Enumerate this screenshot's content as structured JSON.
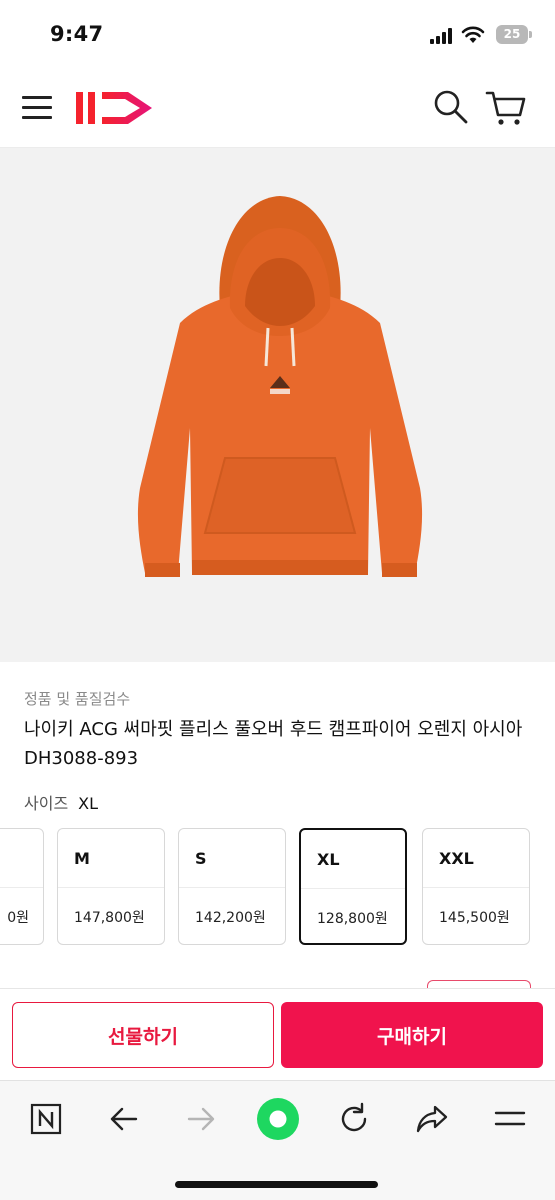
{
  "status_bar": {
    "time": "9:47",
    "battery": "25"
  },
  "header": {
    "logo_text": "11st",
    "icons": [
      "menu-icon",
      "search-icon",
      "cart-icon"
    ]
  },
  "product": {
    "authentic_label": "정품 및 품질검수",
    "title": "나이키 ACG 써마핏 플리스 풀오버 후드 캠프파이어 오렌지 아시아 DH3088-893",
    "size_label": "사이즈",
    "selected_size": "XL"
  },
  "size_options": [
    {
      "size": "",
      "price": "0원"
    },
    {
      "size": "M",
      "price": "147,800원"
    },
    {
      "size": "S",
      "price": "142,200원"
    },
    {
      "size": "XL",
      "price": "128,800원"
    },
    {
      "size": "XXL",
      "price": "145,500원"
    }
  ],
  "actions": {
    "gift_label": "선물하기",
    "buy_label": "구매하기"
  },
  "browser_toolbar": {
    "icons": [
      "naver-n-icon",
      "back-arrow-icon",
      "forward-arrow-icon",
      "green-home-icon",
      "refresh-icon",
      "share-icon",
      "menu-lines-icon"
    ]
  },
  "colors": {
    "brand_red": "#f0134d",
    "hoodie_orange": "#e8692c",
    "selected_border": "#111111"
  }
}
